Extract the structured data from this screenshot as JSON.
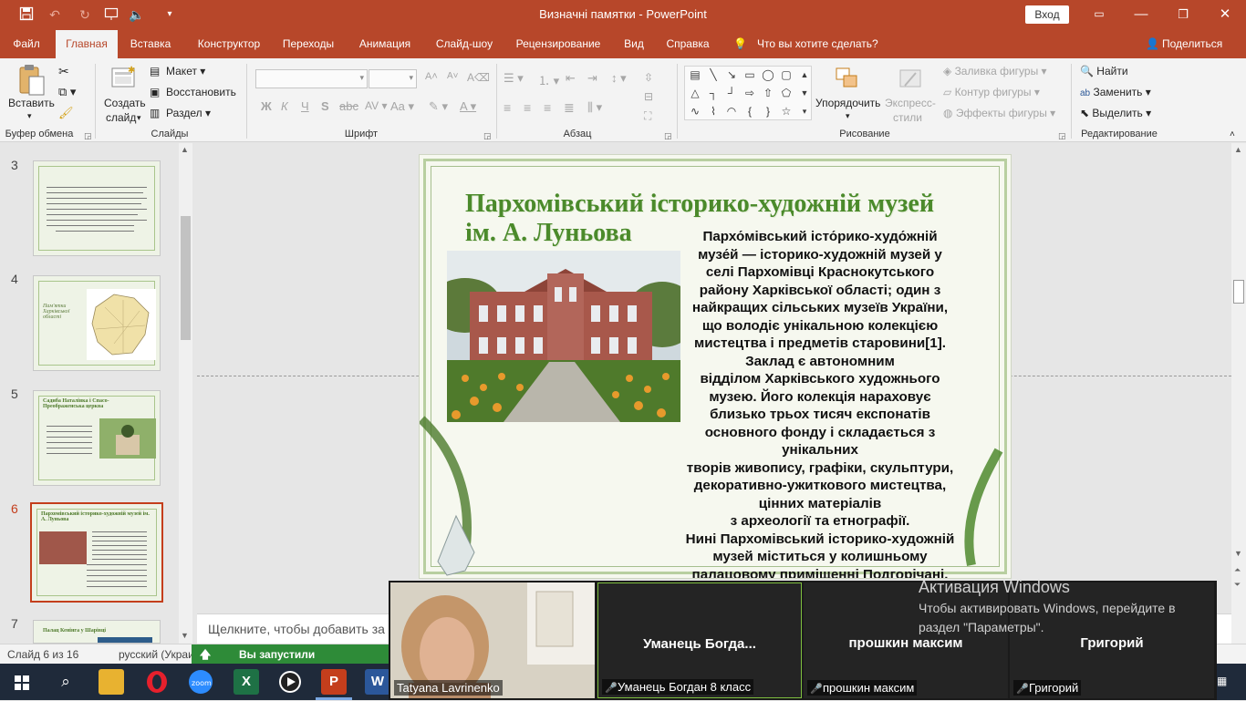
{
  "window": {
    "title": "Визначні памятки  -  PowerPoint",
    "sign_in": "Вход"
  },
  "tabs": [
    "Файл",
    "Главная",
    "Вставка",
    "Конструктор",
    "Переходы",
    "Анимация",
    "Слайд-шоу",
    "Рецензирование",
    "Вид",
    "Справка",
    "Что вы хотите сделать?",
    "Поделиться"
  ],
  "ribbon": {
    "clipboard": {
      "paste": "Вставить",
      "label": "Буфер обмена"
    },
    "slides": {
      "new_slide_1": "Создать",
      "new_slide_2": "слайд",
      "layout": "Макет",
      "reset": "Восстановить",
      "section": "Раздел",
      "label": "Слайды"
    },
    "font": {
      "label": "Шрифт",
      "bold": "Ж",
      "italic": "К",
      "underline": "Ч",
      "strike": "S",
      "aa": "Aa"
    },
    "paragraph": {
      "label": "Абзац"
    },
    "drawing": {
      "arrange_1": "Упорядочить",
      "styles_1": "Экспресс-",
      "styles_2": "стили",
      "fill": "Заливка фигуры",
      "outline": "Контур фигуры",
      "effects": "Эффекты фигуры",
      "label": "Рисование"
    },
    "editing": {
      "find": "Найти",
      "replace": "Заменить",
      "select": "Выделить",
      "label": "Редактирование"
    }
  },
  "thumbnails": [
    {
      "num": "3",
      "title": ""
    },
    {
      "num": "4",
      "title": "Пам'ятки Харківської області"
    },
    {
      "num": "5",
      "title": "Садиба Наталівка і Спасо-Преображенська церква"
    },
    {
      "num": "6",
      "title": "Пархомівський історико-художній музей ім. А. Луньова"
    },
    {
      "num": "7",
      "title": "Палац Кенінга у Шарівці"
    }
  ],
  "slide": {
    "title_line1": "Пархомівський історико-художній музей",
    "title_line2": "ім. А. Луньова",
    "body": [
      "Пархо́мівський істо́рико-худо́жній",
      "музе́й — історико-художній музей у",
      "селі Пархомівці Краснокутського",
      "району Харківської області; один з",
      "найкращих сільських музеїв України,",
      "що володіє унікальною колекцією",
      "мистецтва і предметів старовини[1].",
      "Заклад є автономним",
      "відділом Харківського художнього",
      "музею. Його колекція нараховує",
      "близько трьох тисяч експонатів",
      "основного фонду і складається з",
      "унікальних",
      "творів живопису, графіки, скульптури,",
      "декоративно-ужиткового мистецтва,",
      "цінних матеріалів",
      "з археології та етнографії.",
      "Нині Пархомівський історико-художній",
      "музей міститься у колишньому",
      "палацовому приміщенні Подгорічані."
    ]
  },
  "notes": {
    "placeholder": "Щелкните, чтобы добавить за"
  },
  "status": {
    "slide_count": "Слайд 6 из 16",
    "language": "русский (Украи",
    "share_banner": "Вы запустили демонстраци"
  },
  "zoom": {
    "tiles": [
      {
        "big": "",
        "small": "Tatyana Lavrinenko"
      },
      {
        "big": "Уманець  Богда...",
        "small": "Уманець Богдан 8 класс"
      },
      {
        "big": "прошкин максим",
        "small": "прошкин максим"
      },
      {
        "big": "Григорий",
        "small": "Григорий"
      }
    ]
  },
  "activation": {
    "title": "Активация Windows",
    "subtitle": "Чтобы активировать Windows, перейдите в раздел \"Параметры\"."
  },
  "colors": {
    "accent": "#b7472a",
    "slide_title": "#4b8a2b",
    "share_banner": "#2e8b38"
  }
}
